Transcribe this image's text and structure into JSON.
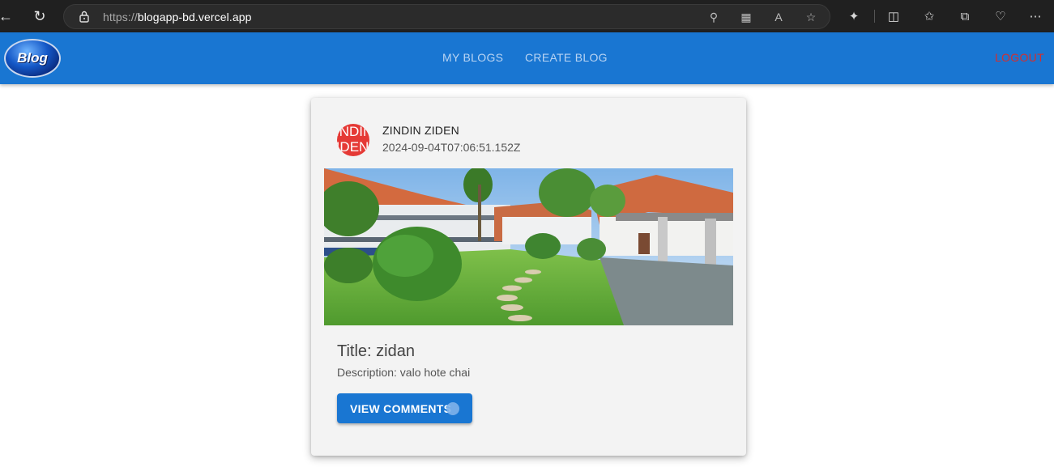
{
  "browser": {
    "url_protocol": "https://",
    "url_host": "blogapp-bd.vercel.app"
  },
  "app_bar": {
    "logo_text": "Blog",
    "nav": [
      {
        "label": "MY BLOGS"
      },
      {
        "label": "CREATE BLOG"
      }
    ],
    "logout_label": "LOGOUT",
    "color": "#1976d2",
    "logout_color": "#d32f2f"
  },
  "post": {
    "avatar_text_line1": "INDIN",
    "avatar_text_line2": "IDEN",
    "avatar_color": "#e53935",
    "author": "ZINDIN ZIDEN",
    "date": "2024-09-04T07:06:51.152Z",
    "title": "Title: zidan",
    "description": "Description: valo hote chai",
    "button_label": "VIEW COMMENTS"
  }
}
